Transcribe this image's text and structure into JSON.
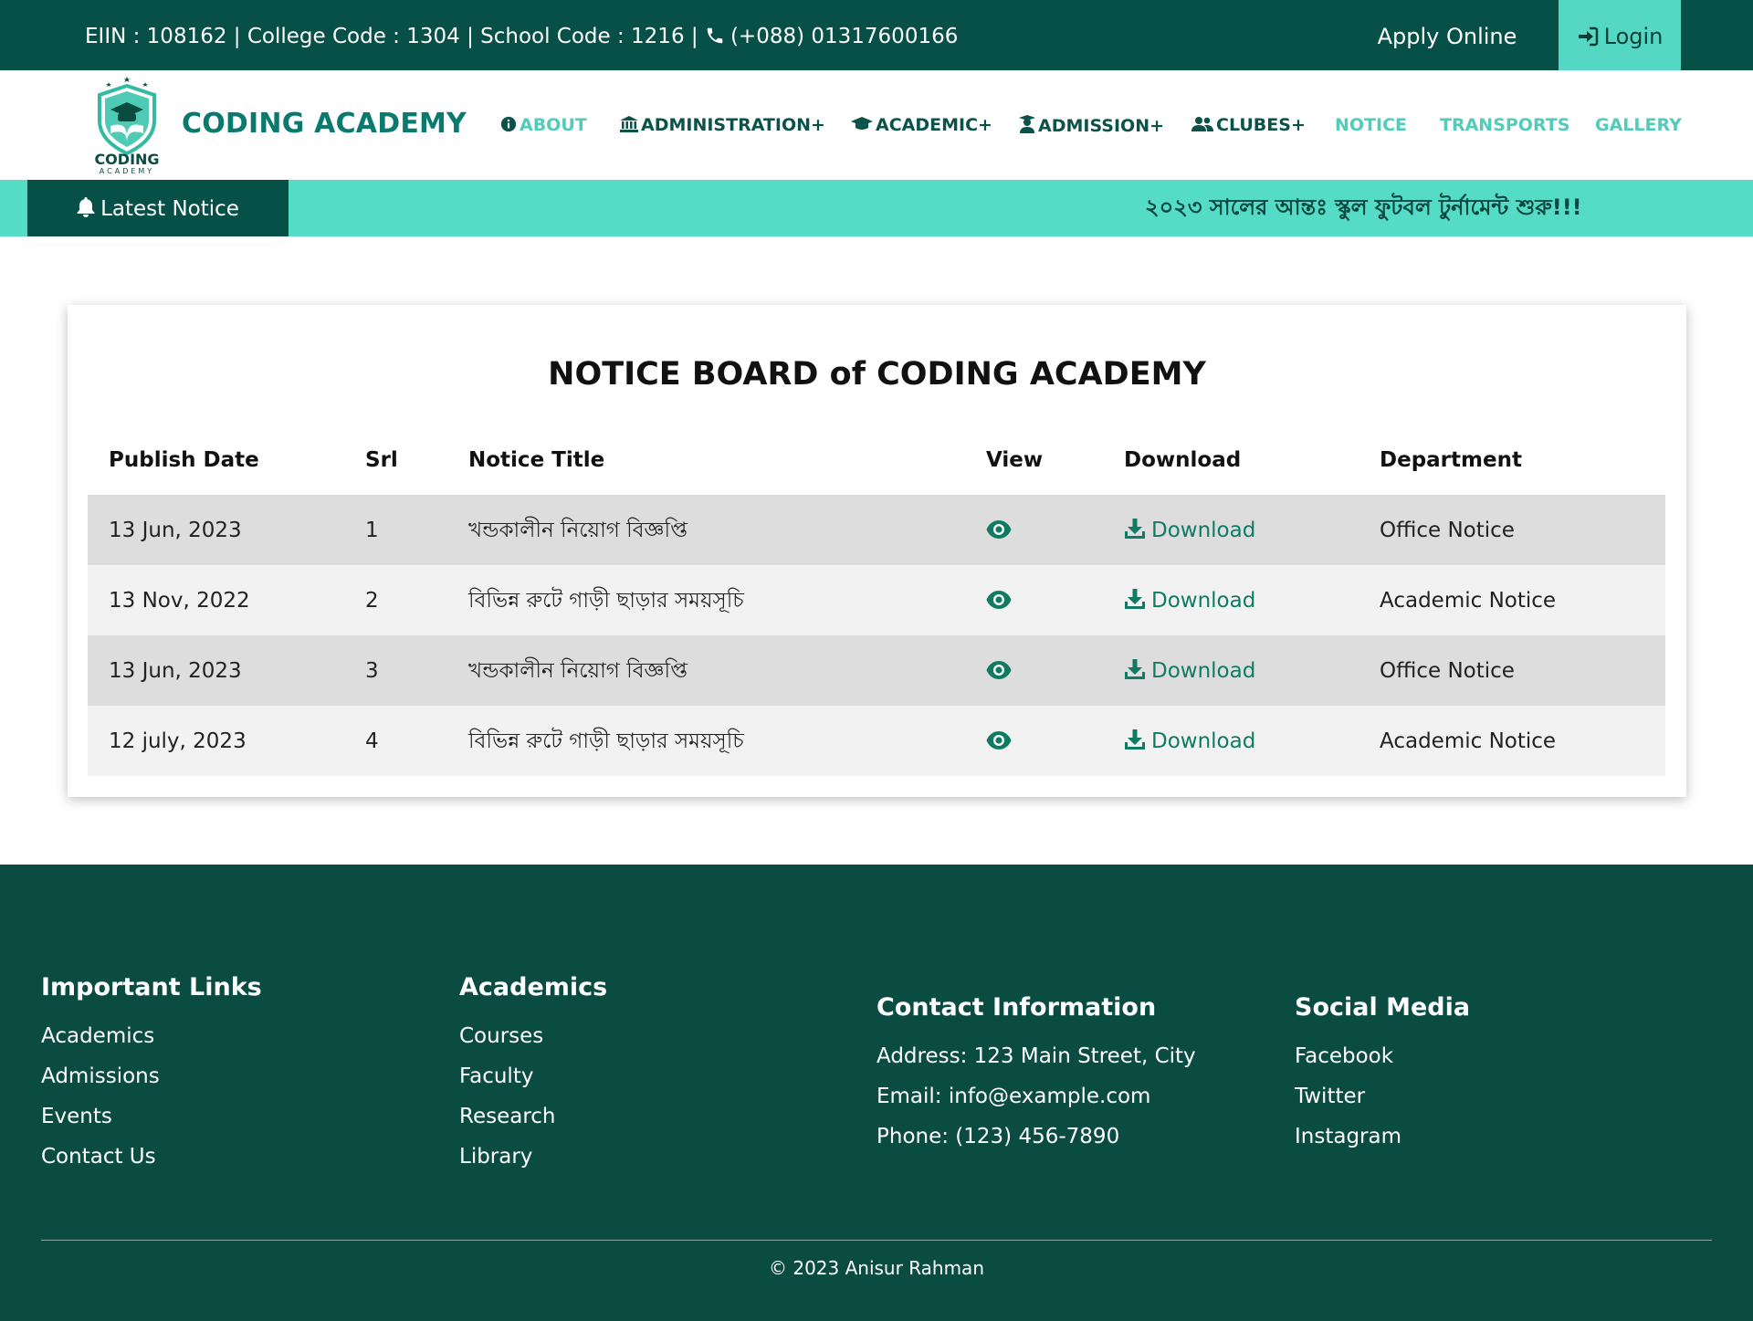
{
  "topbar": {
    "info_text": "EIIN : 108162 | College Code : 1304 | School Code : 1216 |",
    "phone": "(+088) 01317600166",
    "apply_label": "Apply Online",
    "login_label": "Login"
  },
  "brand": {
    "logo_text": "CODING",
    "logo_subtext": "ACADEMY",
    "name": "CODING ACADEMY"
  },
  "nav": {
    "about": "ABOUT",
    "administration": "ADMINISTRATION+",
    "academic": "ACADEMIC+",
    "admission": "ADMISSION+",
    "clubes": "CLUBES+",
    "notice": "NOTICE",
    "transports": "TRANSPORTS",
    "gallery": "GALLERY"
  },
  "notice_strip": {
    "label": "Latest Notice",
    "marquee_text": "২০২৩ সালের আন্তঃ স্কুল ফুটবল টুর্নামেন্ট শুরু!!!"
  },
  "board": {
    "title": "NOTICE BOARD of CODING ACADEMY",
    "columns": [
      "Publish Date",
      "Srl",
      "Notice Title",
      "View",
      "Download",
      "Department"
    ],
    "rows": [
      {
        "date": "13 Jun, 2023",
        "srl": "1",
        "title": "খন্ডকালীন নিয়োগ বিজ্ঞপ্তি",
        "download": "Download",
        "department": "Office Notice"
      },
      {
        "date": "13 Nov, 2022",
        "srl": "2",
        "title": "বিভিন্ন রুটে গাড়ী ছাড়ার সময়সূচি",
        "download": "Download",
        "department": "Academic Notice"
      },
      {
        "date": "13 Jun, 2023",
        "srl": "3",
        "title": "খন্ডকালীন নিয়োগ বিজ্ঞপ্তি",
        "download": "Download",
        "department": "Office Notice"
      },
      {
        "date": "12 july, 2023",
        "srl": "4",
        "title": "বিভিন্ন রুটে গাড়ী ছাড়ার সময়সূচি",
        "download": "Download",
        "department": "Academic Notice"
      }
    ]
  },
  "footer": {
    "important": {
      "heading": "Important Links",
      "links": [
        "Academics",
        "Admissions",
        "Events",
        "Contact Us"
      ]
    },
    "academics": {
      "heading": "Academics",
      "links": [
        "Courses",
        "Faculty",
        "Research",
        "Library"
      ]
    },
    "contact": {
      "heading": "Contact Information",
      "lines": [
        "Address: 123 Main Street, City",
        "Email: info@example.com",
        "Phone: (123) 456-7890"
      ]
    },
    "social": {
      "heading": "Social Media",
      "links": [
        "Facebook",
        "Twitter",
        "Instagram"
      ]
    },
    "copyright": "© 2023 Anisur Rahman"
  },
  "colors": {
    "dark_green": "#075048",
    "accent_teal": "#55dcc6",
    "brand_teal": "#0a7a6e",
    "footer_bg": "#0a4c42"
  }
}
